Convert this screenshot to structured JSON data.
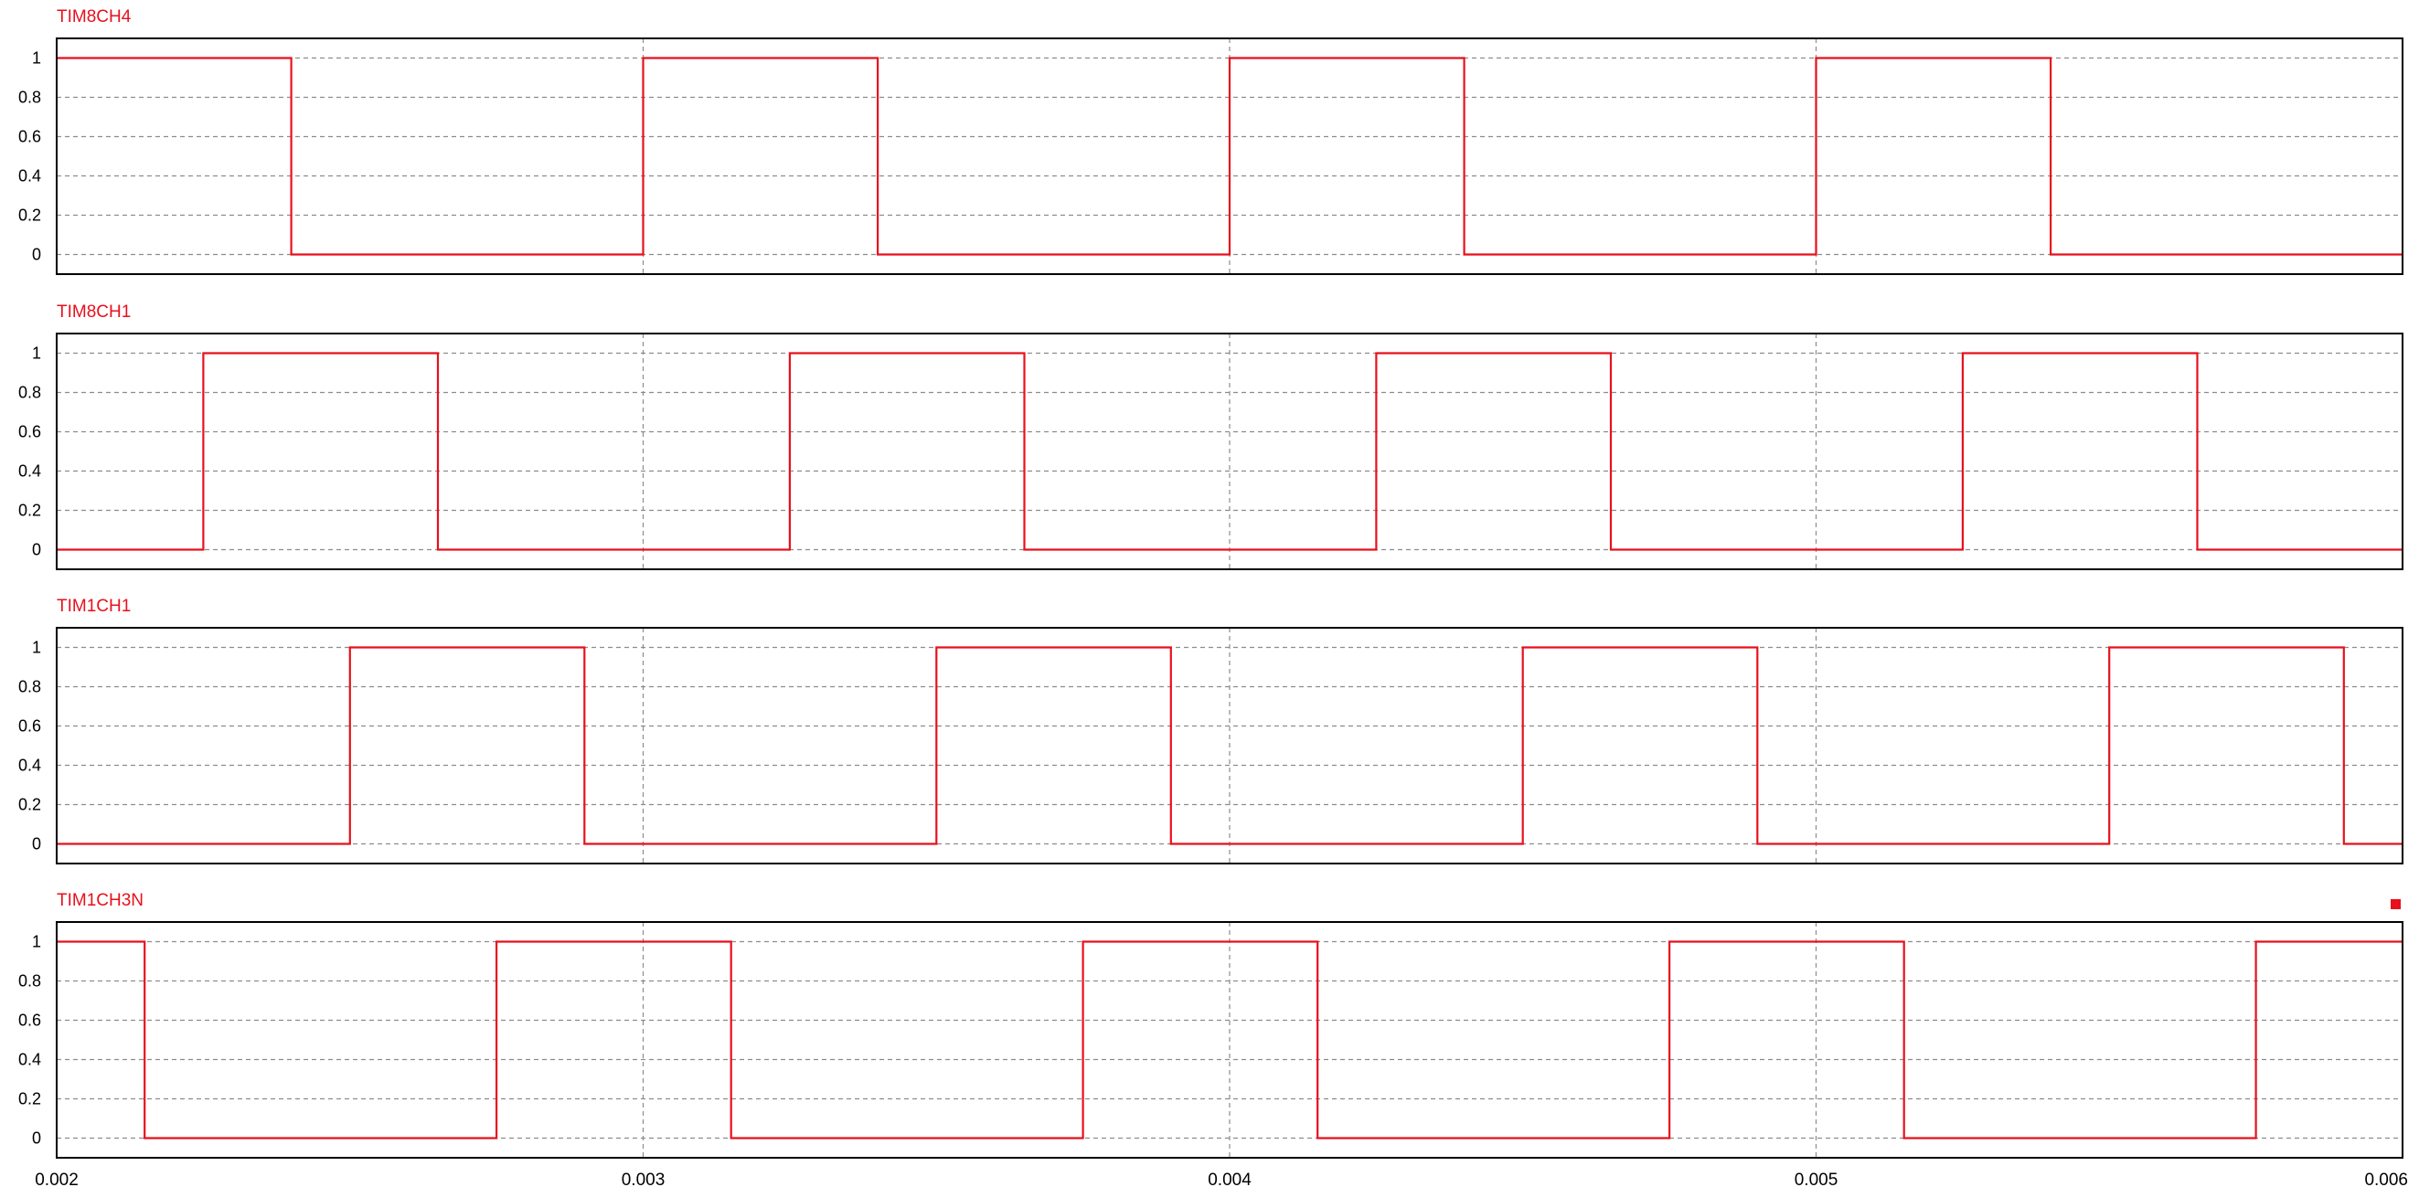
{
  "colors": {
    "trace": "#e8101c",
    "frame": "#000000",
    "grid": "#8c8c8c",
    "tick_text": "#000000"
  },
  "chart_data": [
    {
      "type": "line",
      "step": true,
      "title": "TIM8CH4",
      "xlim": [
        0.002,
        0.006
      ],
      "ylim": [
        -0.1,
        1.1
      ],
      "y_ticks": [
        "0",
        "0.2",
        "0.4",
        "0.6",
        "0.8",
        "1"
      ],
      "grid": true,
      "x": [
        0.002,
        0.0024,
        0.002,
        0.0024,
        0.003,
        0.0034,
        0.004,
        0.0044,
        0.005,
        0.0054,
        0.006
      ],
      "y_x": [
        0.002,
        0.0024,
        0.0024,
        0.003,
        0.003,
        0.0034,
        0.0034,
        0.004,
        0.004,
        0.0044,
        0.0044,
        0.005,
        0.005,
        0.0054,
        0.0054,
        0.006
      ],
      "y": [
        1,
        1,
        0,
        0,
        1,
        1,
        0,
        0,
        1,
        1,
        0,
        0,
        1,
        1,
        0,
        0
      ]
    },
    {
      "type": "line",
      "step": true,
      "title": "TIM8CH1",
      "xlim": [
        0.002,
        0.006
      ],
      "ylim": [
        -0.1,
        1.1
      ],
      "y_ticks": [
        "0",
        "0.2",
        "0.4",
        "0.6",
        "0.8",
        "1"
      ],
      "grid": true,
      "y_x": [
        0.002,
        0.00225,
        0.00225,
        0.00265,
        0.00265,
        0.00325,
        0.00325,
        0.00365,
        0.00365,
        0.00425,
        0.00425,
        0.00465,
        0.00465,
        0.00525,
        0.00525,
        0.00565,
        0.00565,
        0.006
      ],
      "y": [
        0,
        0,
        1,
        1,
        0,
        0,
        1,
        1,
        0,
        0,
        1,
        1,
        0,
        0,
        1,
        1,
        0,
        0
      ]
    },
    {
      "type": "line",
      "step": true,
      "title": "TIM1CH1",
      "xlim": [
        0.002,
        0.006
      ],
      "ylim": [
        -0.1,
        1.1
      ],
      "y_ticks": [
        "0",
        "0.2",
        "0.4",
        "0.6",
        "0.8",
        "1"
      ],
      "grid": true,
      "y_x": [
        0.002,
        0.0025,
        0.0025,
        0.0029,
        0.0029,
        0.0035,
        0.0035,
        0.0039,
        0.0039,
        0.0045,
        0.0045,
        0.0049,
        0.0049,
        0.0055,
        0.0055,
        0.0059,
        0.0059,
        0.006
      ],
      "y": [
        0,
        0,
        1,
        1,
        0,
        0,
        1,
        1,
        0,
        0,
        1,
        1,
        0,
        0,
        1,
        1,
        0,
        0
      ]
    },
    {
      "type": "line",
      "step": true,
      "title": "TIM1CH3N",
      "xlim": [
        0.002,
        0.006
      ],
      "ylim": [
        -0.1,
        1.1
      ],
      "y_ticks": [
        "0",
        "0.2",
        "0.4",
        "0.6",
        "0.8",
        "1"
      ],
      "x_ticks": [
        "0.002",
        "0.003",
        "0.004",
        "0.005",
        "0.006"
      ],
      "grid": true,
      "y_x": [
        0.002,
        0.00215,
        0.00215,
        0.00275,
        0.00275,
        0.00315,
        0.00315,
        0.00375,
        0.00375,
        0.00415,
        0.00415,
        0.00475,
        0.00475,
        0.00515,
        0.00515,
        0.00575,
        0.00575,
        0.006
      ],
      "y": [
        1,
        1,
        0,
        0,
        1,
        1,
        0,
        0,
        1,
        1,
        0,
        0,
        1,
        1,
        0,
        0,
        1,
        1
      ]
    }
  ]
}
